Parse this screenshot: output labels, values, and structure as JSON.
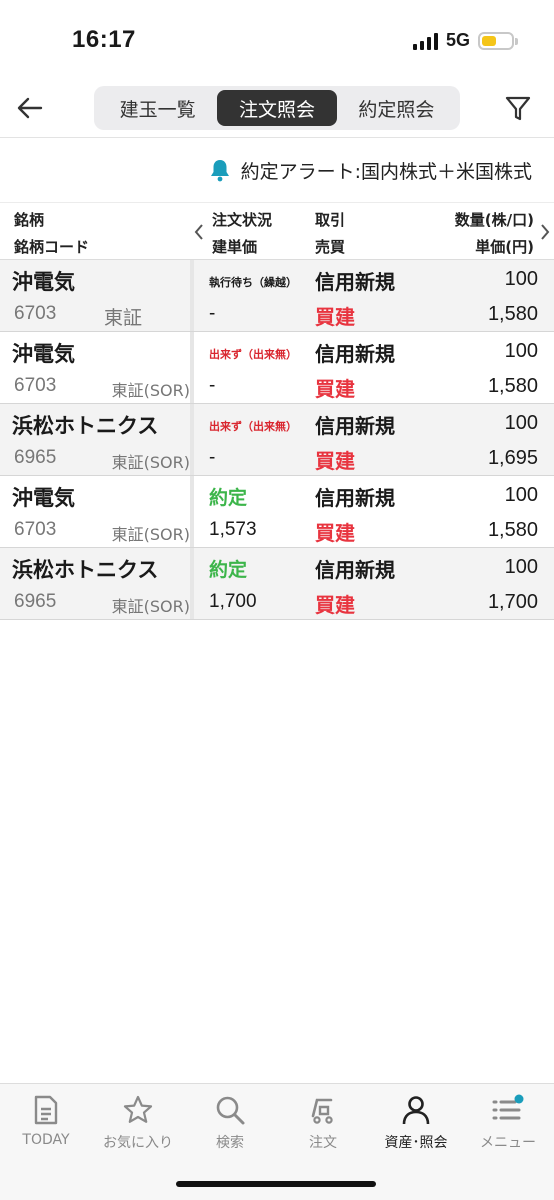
{
  "status_bar": {
    "time": "16:17",
    "network": "5G",
    "signal_bars": 4,
    "battery_level": 0.5,
    "battery_color": "#f5c518"
  },
  "header": {
    "back_icon": "arrow-left-icon",
    "filter_icon": "filter-icon",
    "tabs": [
      {
        "label": "建玉一覧",
        "active": false
      },
      {
        "label": "注文照会",
        "active": true
      },
      {
        "label": "約定照会",
        "active": false
      }
    ]
  },
  "alert": {
    "icon": "bell-icon",
    "text": "約定アラート:国内株式＋米国株式",
    "icon_color": "#1a9dbb"
  },
  "table": {
    "headers": {
      "name": "銘柄",
      "code": "銘柄コード",
      "status": "注文状況",
      "build_price": "建単価",
      "trade": "取引",
      "side": "売買",
      "qty": "数量(株/口)",
      "unit_price": "単価(円)"
    },
    "rows": [
      {
        "name": "沖電気",
        "code": "6703",
        "market": "東証",
        "status": "執行待ち（繰越）",
        "status_color": "#1a1a1a",
        "build_price": "-",
        "trade": "信用新規",
        "side": "買建",
        "qty": "100",
        "unit_price": "1,580"
      },
      {
        "name": "沖電気",
        "code": "6703",
        "market": "東証(SOR)",
        "status": "出来ず（出来無）",
        "status_color": "#d9262f",
        "build_price": "-",
        "trade": "信用新規",
        "side": "買建",
        "qty": "100",
        "unit_price": "1,580"
      },
      {
        "name": "浜松ホトニクス",
        "code": "6965",
        "market": "東証(SOR)",
        "status": "出来ず（出来無）",
        "status_color": "#d9262f",
        "build_price": "-",
        "trade": "信用新規",
        "side": "買建",
        "qty": "100",
        "unit_price": "1,695"
      },
      {
        "name": "沖電気",
        "code": "6703",
        "market": "東証(SOR)",
        "status": "約定",
        "status_color": "#3cb54a",
        "build_price": "1,573",
        "trade": "信用新規",
        "side": "買建",
        "qty": "100",
        "unit_price": "1,580"
      },
      {
        "name": "浜松ホトニクス",
        "code": "6965",
        "market": "東証(SOR)",
        "status": "約定",
        "status_color": "#3cb54a",
        "build_price": "1,700",
        "trade": "信用新規",
        "side": "買建",
        "qty": "100",
        "unit_price": "1,700"
      }
    ]
  },
  "bottom_nav": {
    "items": [
      {
        "label": "TODAY",
        "icon": "document-icon",
        "active": false
      },
      {
        "label": "お気に入り",
        "icon": "star-icon",
        "active": false
      },
      {
        "label": "検索",
        "icon": "search-icon",
        "active": false
      },
      {
        "label": "注文",
        "icon": "cart-icon",
        "active": false
      },
      {
        "label": "資産･照会",
        "icon": "person-icon",
        "active": true
      },
      {
        "label": "メニュー",
        "icon": "menu-icon",
        "active": false,
        "badge_color": "#1a9dbb"
      }
    ]
  }
}
